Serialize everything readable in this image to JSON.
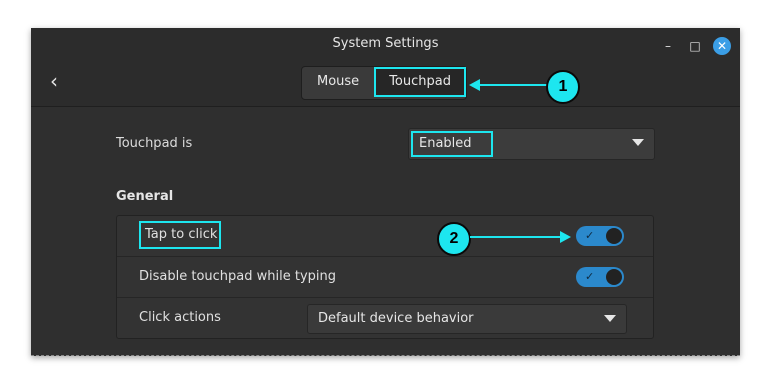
{
  "window": {
    "title": "System Settings"
  },
  "nav": {
    "tabs": [
      {
        "label": "Mouse"
      },
      {
        "label": "Touchpad"
      }
    ],
    "active_tab": "Touchpad"
  },
  "touchpad_is": {
    "label": "Touchpad is",
    "value": "Enabled"
  },
  "general": {
    "title": "General",
    "rows": [
      {
        "label": "Tap to click",
        "toggle": "on"
      },
      {
        "label": "Disable touchpad while typing",
        "toggle": "on"
      },
      {
        "label": "Click actions",
        "value": "Default device behavior"
      }
    ]
  },
  "annotations": [
    {
      "number": "1"
    },
    {
      "number": "2"
    }
  ],
  "colors": {
    "accent": "#1de6ef",
    "toggle_on": "#2b89cc",
    "close_button": "#3b9ee6",
    "window_bg": "#2f2f2f"
  }
}
